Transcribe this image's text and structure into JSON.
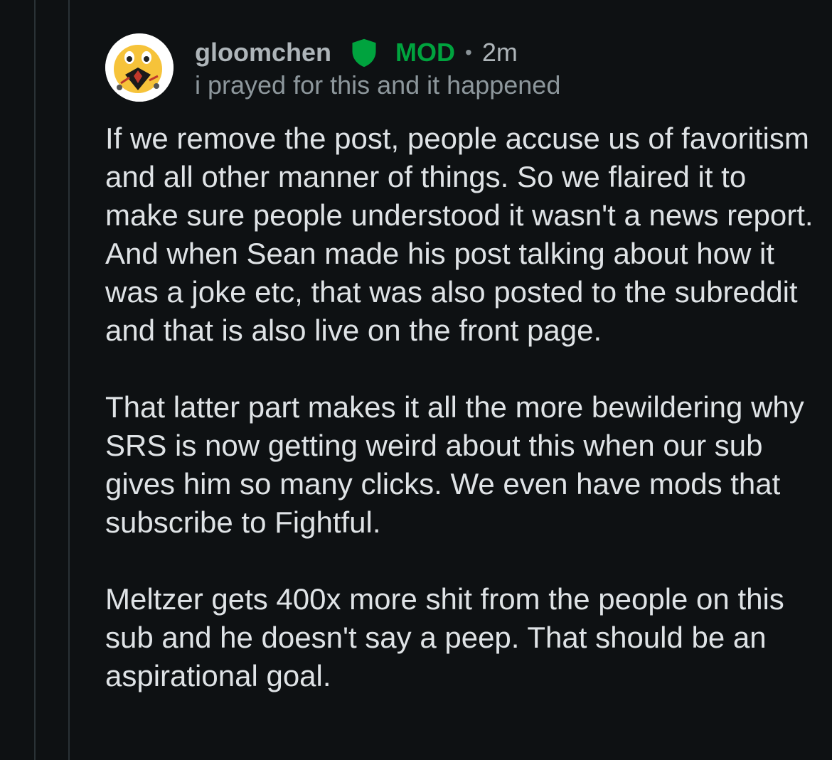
{
  "comment": {
    "username": "gloomchen",
    "badge": "MOD",
    "age": "2m",
    "separator": "•",
    "flair": "i prayed for this and it happened",
    "avatar_icon": "crying-emoji-avatar-icon",
    "shield_icon": "mod-shield-icon",
    "paragraphs": [
      "If we remove the post, people accuse us of favoritism and all other manner of things. So we flaired it to make sure people understood it wasn't a news report. And when Sean made his post talking about how it was a joke etc, that was also posted to the subreddit and that is also live on the front page.",
      "That latter part makes it all the more bewildering why SRS is now getting weird about this when our sub gives him so many clicks. We even have mods that subscribe to Fightful.",
      "Meltzer gets 400x more shit from the people on this sub and he doesn't say a peep. That should be an aspirational goal."
    ]
  },
  "colors": {
    "background": "#0e1113",
    "mod_green": "#00a33e",
    "username": "#aeb5b9",
    "flair": "#8d979c",
    "body_text": "#dfe3e6"
  }
}
